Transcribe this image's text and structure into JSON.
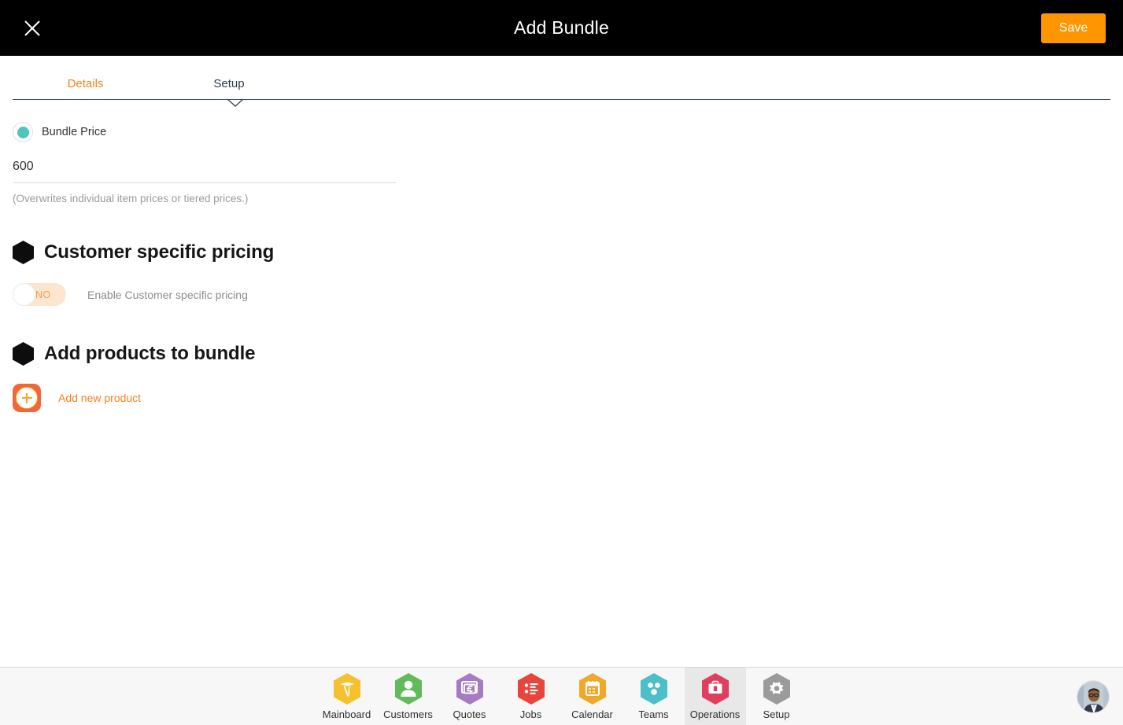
{
  "header": {
    "title": "Add Bundle",
    "close_icon": "close-icon",
    "save_label": "Save",
    "save_color": "#ff9500"
  },
  "tabs": {
    "items": [
      {
        "label": "Details",
        "active": false,
        "color": "#f58220"
      },
      {
        "label": "Setup",
        "active": true,
        "color": "#2b3d4f"
      }
    ]
  },
  "form": {
    "bundle_price": {
      "radio_label": "Bundle Price",
      "radio_selected": true,
      "radio_color": "#4ec6bd",
      "value": "600",
      "placeholder": "Bundle Price",
      "hint": "(Overwrites individual item prices or tiered prices.)"
    },
    "customer_pricing": {
      "title": "Customer specific pricing",
      "toggle_state": "NO",
      "toggle_on": false,
      "toggle_label": "Enable Customer specific pricing",
      "toggle_track_color": "#fce6d0"
    },
    "add_products": {
      "title": "Add products to bundle",
      "add_link": "Add new product",
      "add_icon": "plus-icon",
      "accent_color": "#f58220"
    }
  },
  "bottom_nav": {
    "items": [
      {
        "label": "Mainboard",
        "icon": "mainboard-icon",
        "color": "#f5c12e",
        "active": false
      },
      {
        "label": "Customers",
        "icon": "customers-icon",
        "color": "#62bb5b",
        "active": false
      },
      {
        "label": "Quotes",
        "icon": "quotes-icon",
        "color": "#a77bc4",
        "active": false
      },
      {
        "label": "Jobs",
        "icon": "jobs-icon",
        "color": "#e8453c",
        "active": false
      },
      {
        "label": "Calendar",
        "icon": "calendar-icon",
        "color": "#f0a82a",
        "active": false
      },
      {
        "label": "Teams",
        "icon": "teams-icon",
        "color": "#4bc0c8",
        "active": false
      },
      {
        "label": "Operations",
        "icon": "operations-icon",
        "color": "#e03e5c",
        "active": true
      },
      {
        "label": "Setup",
        "icon": "setup-gear-icon",
        "color": "#9b9b9b",
        "active": false
      }
    ],
    "avatar": "user-avatar"
  }
}
